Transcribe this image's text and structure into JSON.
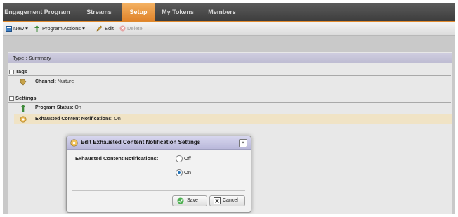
{
  "nav": {
    "tabs": [
      {
        "label": "Engagement Program",
        "active": false
      },
      {
        "label": "Streams",
        "active": false
      },
      {
        "label": "Setup",
        "active": true
      },
      {
        "label": "My Tokens",
        "active": false
      },
      {
        "label": "Members",
        "active": false
      }
    ]
  },
  "toolbar": {
    "new_label": "New ▾",
    "program_actions_label": "Program Actions ▾",
    "edit_label": "Edit",
    "delete_label": "Delete"
  },
  "summary": {
    "type_row": "Type : Summary",
    "tags_section": "Tags",
    "channel_label": "Channel:",
    "channel_value": "Nurture",
    "settings_section": "Settings",
    "program_status_label": "Program Status:",
    "program_status_value": "On",
    "exhausted_label": "Exhausted Content Notifications:",
    "exhausted_value": "On"
  },
  "dialog": {
    "title": "Edit Exhausted Content Notification Settings",
    "close_glyph": "×",
    "field_label": "Exhausted Content Notifications:",
    "options": [
      {
        "label": "Off",
        "selected": false
      },
      {
        "label": "On",
        "selected": true
      }
    ],
    "save_label": "Save",
    "cancel_label": "Cancel"
  },
  "colors": {
    "active_tab": "#e0832a",
    "nav_bg": "#4a4a4a",
    "highlight_row": "#f0e3c5",
    "dialog_title_bg": "#c8c7e4"
  },
  "icons": [
    "new-icon",
    "program-actions-icon",
    "edit-icon",
    "delete-icon",
    "tags-icon",
    "program-status-icon",
    "notification-icon",
    "dialog-gear-icon",
    "save-check-icon",
    "cancel-x-icon"
  ]
}
